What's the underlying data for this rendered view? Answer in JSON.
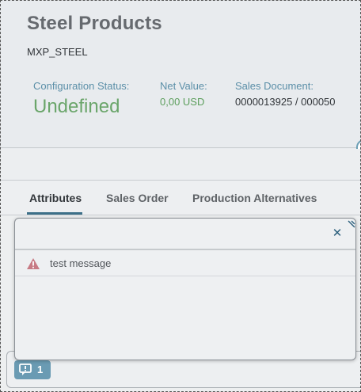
{
  "header": {
    "title": "Steel Products",
    "subtitle": "MXP_STEEL",
    "attributes": [
      {
        "label": "Configuration Status:",
        "value": "Undefined"
      },
      {
        "label": "Net Value:",
        "value": "0,00 USD"
      },
      {
        "label": "Sales Document:",
        "value": "0000013925 / 000050"
      }
    ]
  },
  "tabs": [
    {
      "label": "Attributes",
      "active": true
    },
    {
      "label": "Sales Order",
      "active": false
    },
    {
      "label": "Production Alternatives",
      "active": false
    }
  ],
  "message_popover": {
    "messages": [
      {
        "type": "warning",
        "text": "test message"
      }
    ]
  },
  "footer": {
    "message_count": "1"
  },
  "colors": {
    "status_undefined": "#6aa56a",
    "attr_label": "#5b8fa8",
    "accent": "#3c6f88",
    "warning": "#c77a84"
  }
}
